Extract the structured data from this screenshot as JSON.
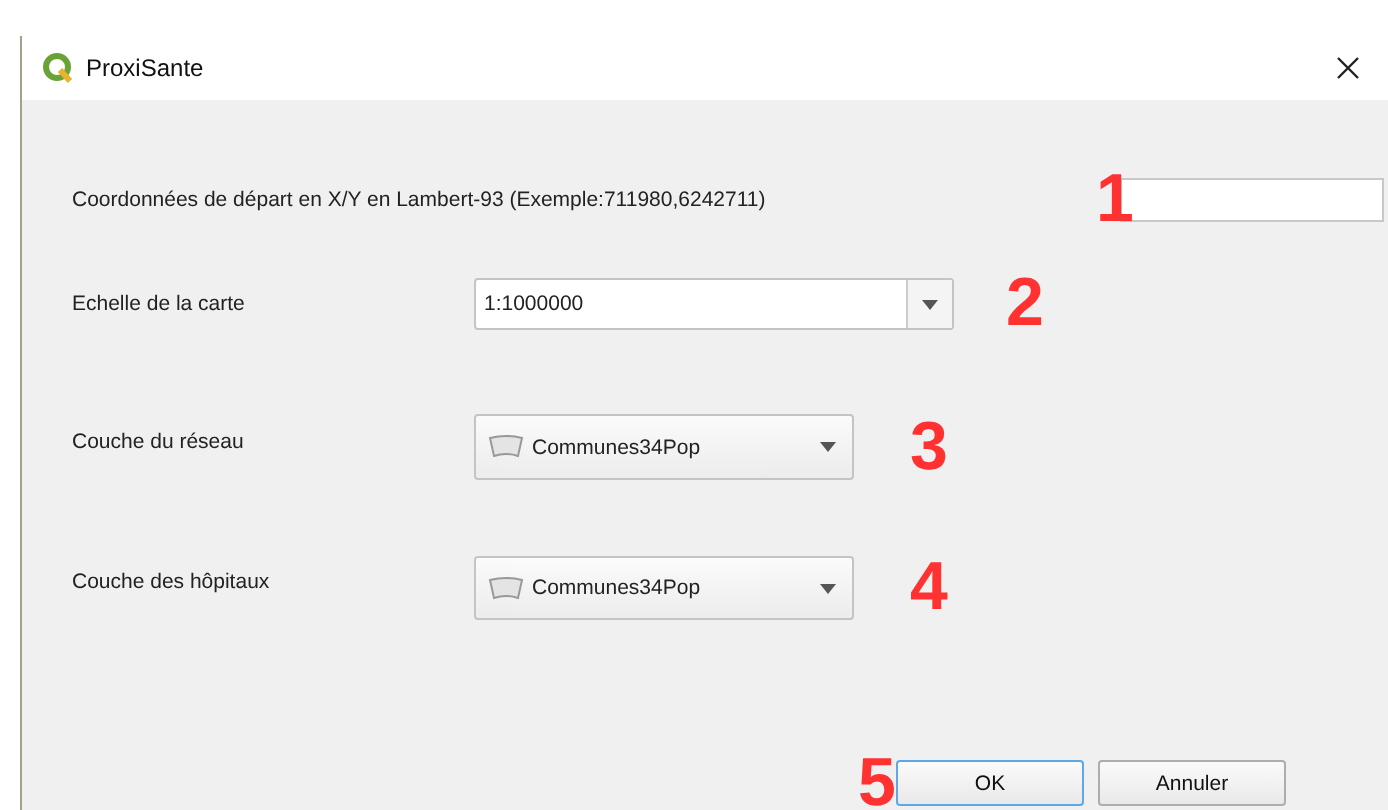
{
  "window": {
    "title": "ProxiSante"
  },
  "rows": [
    {
      "label": "Coordonnées de départ en X/Y en Lambert-93 (Exemple:711980,6242711)",
      "kind": "text",
      "marker": "1"
    },
    {
      "label": "Echelle de la carte",
      "kind": "editable",
      "value": "1:1000000",
      "marker": "2"
    },
    {
      "label": "Couche du réseau",
      "kind": "layer",
      "value": "Communes34Pop",
      "marker": "3"
    },
    {
      "label": "Couche des hôpitaux",
      "kind": "layer",
      "value": "Communes34Pop",
      "marker": "4"
    }
  ],
  "buttons": [
    {
      "label": "OK",
      "default": true,
      "marker": "5"
    },
    {
      "label": "Annuler",
      "default": false
    }
  ]
}
